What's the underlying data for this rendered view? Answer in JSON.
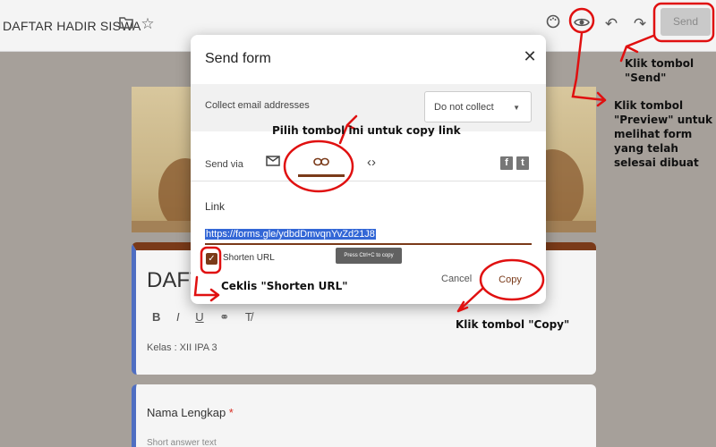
{
  "app": {
    "doc_title": "DAFTAR HADIR SISWA",
    "send_label": "Send"
  },
  "form": {
    "title_fragment": "DAFT",
    "description": "Kelas : XII IPA 3",
    "question_title": "Nama Lengkap",
    "required_mark": "*",
    "question_hint": "Short answer text"
  },
  "modal": {
    "title": "Send form",
    "close_glyph": "✕",
    "collect_label": "Collect email addresses",
    "collect_value": "Do not collect",
    "send_via_label": "Send via",
    "link_label": "Link",
    "link_url": "https://forms.gle/ydbdDmvqnYvZd21J8",
    "shorten_label": "Shorten URL",
    "shorten_checked": true,
    "tooltip": "Press Ctrl+C to copy",
    "cancel_label": "Cancel",
    "copy_label": "Copy"
  },
  "annotations": {
    "send": "Klik tombol \"Send\"",
    "preview": "Klik tombol \"Preview\" untuk melihat form yang telah selesai dibuat",
    "copy_link": "Pilih tombol ini untuk copy link",
    "shorten": "Ceklis \"Shorten URL\"",
    "copy": "Klik tombol \"Copy\""
  },
  "colors": {
    "accent": "#7a3a19",
    "annotation_red": "#e01010",
    "selection_blue": "#3367d6"
  },
  "icons": [
    "folder-icon",
    "star-icon",
    "palette-icon",
    "eye-icon",
    "undo-icon",
    "redo-icon",
    "mail-icon",
    "link-icon",
    "code-icon",
    "facebook-icon",
    "twitter-icon",
    "close-icon",
    "check-icon"
  ]
}
